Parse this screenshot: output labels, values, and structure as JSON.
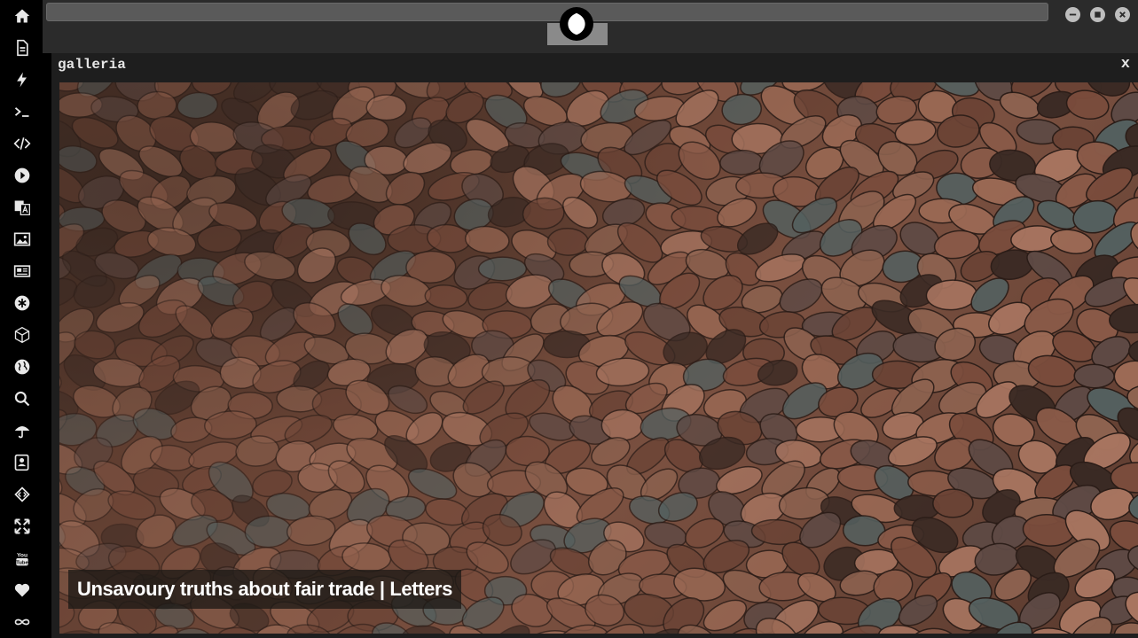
{
  "sidebar": {
    "items": [
      {
        "icon": "home-icon"
      },
      {
        "icon": "document-icon"
      },
      {
        "icon": "bolt-icon"
      },
      {
        "icon": "terminal-icon"
      },
      {
        "icon": "code-icon"
      },
      {
        "icon": "play-icon"
      },
      {
        "icon": "translate-icon"
      },
      {
        "icon": "image-icon"
      },
      {
        "icon": "newspaper-icon"
      },
      {
        "icon": "asterisk-icon"
      },
      {
        "icon": "cube-icon"
      },
      {
        "icon": "globe-icon"
      },
      {
        "icon": "search-icon"
      },
      {
        "icon": "umbrella-icon"
      },
      {
        "icon": "contact-icon"
      },
      {
        "icon": "embed-icon"
      },
      {
        "icon": "expand-icon"
      },
      {
        "icon": "youtube-icon"
      },
      {
        "icon": "heart-icon"
      },
      {
        "icon": "infinity-icon"
      }
    ]
  },
  "header": {
    "logo_icon": "rebel-alliance-icon",
    "window_controls": [
      "minimize",
      "maximize",
      "close"
    ]
  },
  "gallery": {
    "title": "galleria",
    "close_label": "x",
    "caption": "Unsavoury truths about fair trade | Letters"
  },
  "colors": {
    "background": "#000000",
    "panel": "#1e1e1e",
    "topbar": "#2b2b2b",
    "text": "#e6e6e6"
  }
}
